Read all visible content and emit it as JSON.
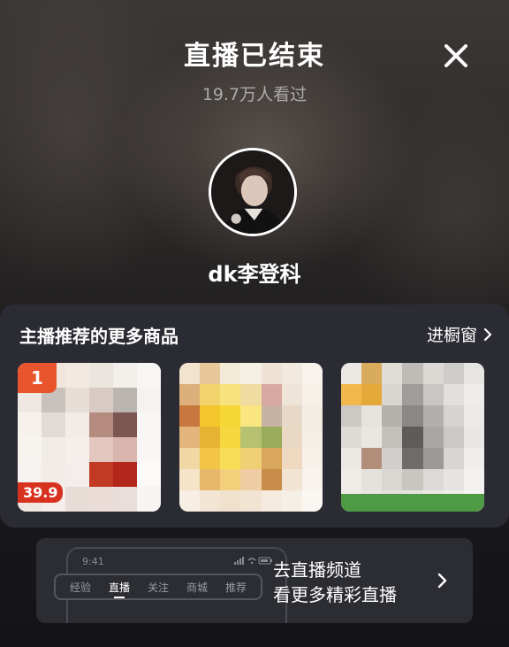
{
  "header": {
    "title": "直播已结束",
    "viewers": "19.7万人看过",
    "close_icon": "close-icon"
  },
  "host": {
    "avatar_icon": "avatar",
    "name": "dk李登科"
  },
  "products": {
    "section_title": "主播推荐的更多商品",
    "shop_link_label": "进橱窗",
    "items": [
      {
        "badge": "1",
        "price": "39.9",
        "image": "blurred product image"
      },
      {
        "image": "blurred product image"
      },
      {
        "image": "blurred product image"
      }
    ]
  },
  "live_channel": {
    "line1": "去直播频道",
    "line2": "看更多精彩直播",
    "mock_time": "9:41",
    "mock_tabs": [
      "经验",
      "直播",
      "关注",
      "商城",
      "推荐"
    ],
    "active_tab": "直播"
  },
  "colors": {
    "accent": "#e8542c",
    "card_bg": "#2b2c33",
    "green": "#4f9a45"
  }
}
